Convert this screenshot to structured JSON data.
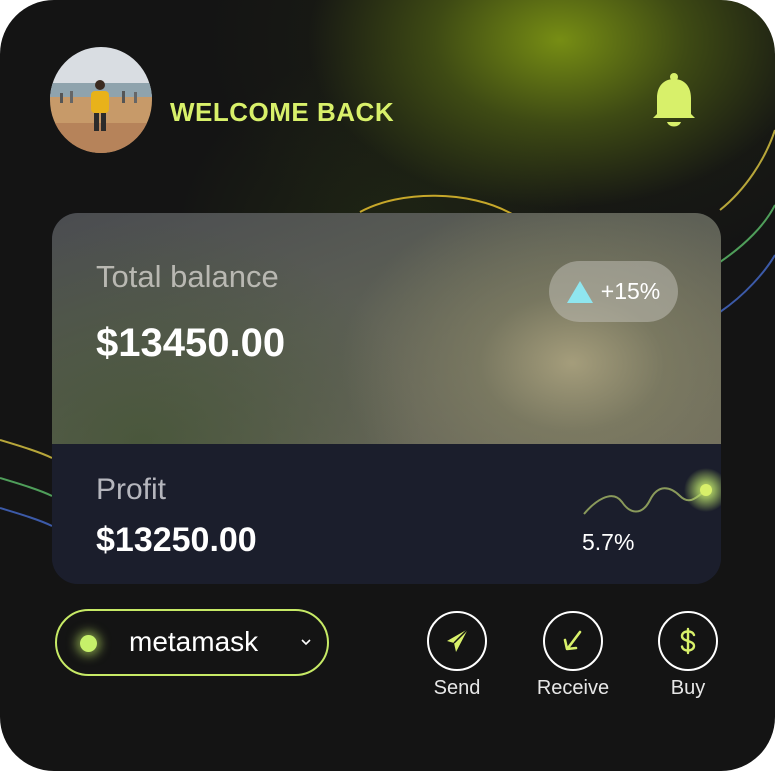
{
  "header": {
    "welcome_text": "WELCOME BACK",
    "avatar_icon": "user-photo",
    "notification_icon": "bell-icon"
  },
  "balance_card": {
    "total_label": "Total balance",
    "total_value": "$13450.00",
    "change_percent": "+15%",
    "change_icon": "triangle-up-icon",
    "profit_label": "Profit",
    "profit_value": "$13250.00",
    "profit_percent": "5.7%"
  },
  "wallet": {
    "name": "metamask",
    "chevron_icon": "chevron-down-icon"
  },
  "actions": [
    {
      "label": "Send",
      "icon": "send-icon"
    },
    {
      "label": "Receive",
      "icon": "receive-arrow-icon"
    },
    {
      "label": "Buy",
      "icon": "dollar-icon"
    }
  ],
  "colors": {
    "accent": "#d8f06a",
    "card_bottom": "#1b1e2c",
    "background": "#141414",
    "trend_up": "#8fe6ef"
  }
}
